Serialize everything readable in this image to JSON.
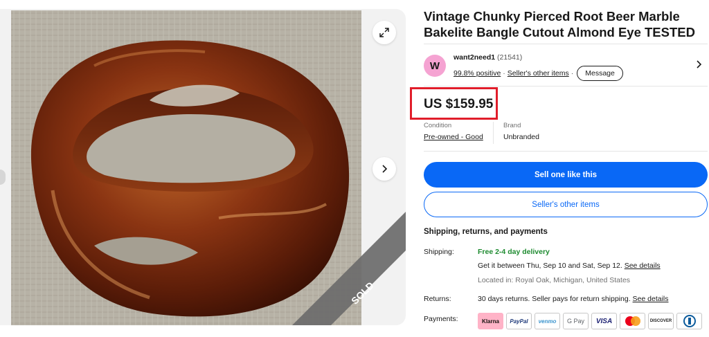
{
  "listing": {
    "title": "Vintage Chunky Pierced Root Beer Marble Bakelite Bangle Cutout Almond Eye TESTED",
    "sold_ribbon": "SOLD"
  },
  "seller": {
    "avatar_letter": "W",
    "name": "want2need1",
    "feedback_count": "(21541)",
    "positive": "99.8% positive",
    "separator": "·",
    "other_items": "Seller's other items",
    "message_label": "Message"
  },
  "price": "US $159.95",
  "item_specifics": {
    "condition_label": "Condition",
    "condition_value": "Pre-owned - Good",
    "brand_label": "Brand",
    "brand_value": "Unbranded"
  },
  "actions": {
    "sell_one": "Sell one like this",
    "other_items": "Seller's other items"
  },
  "shipping": {
    "section_title": "Shipping, returns, and payments",
    "shipping_label": "Shipping:",
    "delivery": "Free 2-4 day delivery",
    "estimate": "Get it between Thu, Sep 10 and Sat, Sep 12.",
    "see_details": "See details",
    "location": "Located in: Royal Oak, Michigan, United States",
    "returns_label": "Returns:",
    "returns_text": "30 days returns. Seller pays for return shipping.",
    "returns_details": "See details",
    "payments_label": "Payments:"
  },
  "payments": [
    "Klarna",
    "PayPal",
    "venmo",
    "G Pay",
    "VISA",
    "",
    "DISCOVER",
    ""
  ],
  "colors": {
    "primary": "#0968f6",
    "price_highlight": "#e11d2a",
    "delivery_green": "#1e8b30",
    "avatar": "#f5a3d2"
  },
  "icons": {
    "expand": "expand-icon",
    "next": "chevron-right-icon",
    "seller_chevron": "chevron-right-icon"
  }
}
